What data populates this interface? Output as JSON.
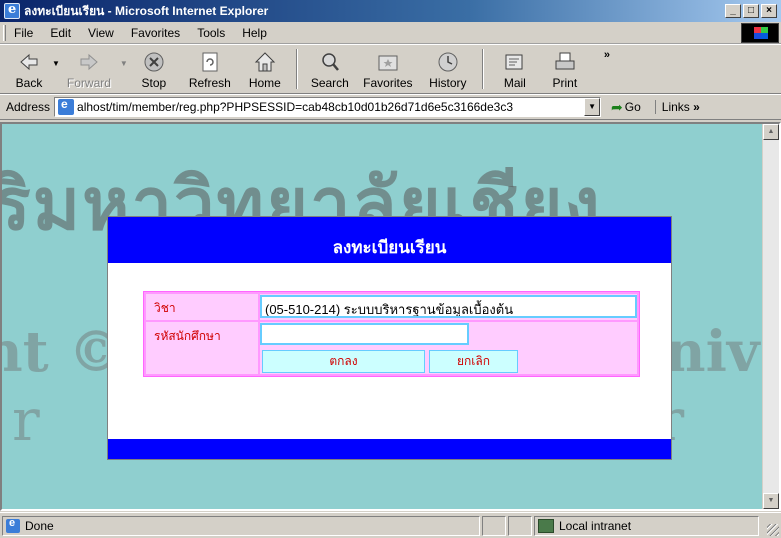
{
  "window": {
    "title": "ลงทะเบียนเรียน - Microsoft Internet Explorer",
    "controls": [
      "_",
      "□",
      "×"
    ]
  },
  "menu": {
    "items": [
      "File",
      "Edit",
      "View",
      "Favorites",
      "Tools",
      "Help"
    ]
  },
  "toolbar": {
    "back": "Back",
    "forward": "Forward",
    "stop": "Stop",
    "refresh": "Refresh",
    "home": "Home",
    "search": "Search",
    "favorites": "Favorites",
    "history": "History",
    "mail": "Mail",
    "print": "Print"
  },
  "address": {
    "label": "Address",
    "url": "alhost/tim/member/reg.php?PHPSESSID=cab48cb10d01b26d71d6e5c3166de3c3",
    "go": "Go",
    "links": "Links"
  },
  "watermark": {
    "line1": "ริมหาวิทยาลัยเชียง",
    "line2": "ht © by Chiang Mai Univ",
    "line3": "r i g h t s   r e s e r"
  },
  "form": {
    "title": "ลงทะเบียนเรียน",
    "subject_label": "วิชา",
    "subject_value": "(05-510-214) ระบบบริหารฐานข้อมูลเบื้องต้น",
    "student_id_label": "รหัสนักศึกษา",
    "student_id_value": "",
    "ok_button": "ตกลง",
    "cancel_button": "ยกเลิก"
  },
  "status": {
    "text": "Done",
    "zone": "Local intranet"
  },
  "colors": {
    "page_bg": "#8fcfcf",
    "header_blue": "#0000ff",
    "table_pink": "#ff99ff",
    "cell_pink": "#ffccff",
    "label_red": "#d00000",
    "button_cyan": "#ccffff"
  }
}
